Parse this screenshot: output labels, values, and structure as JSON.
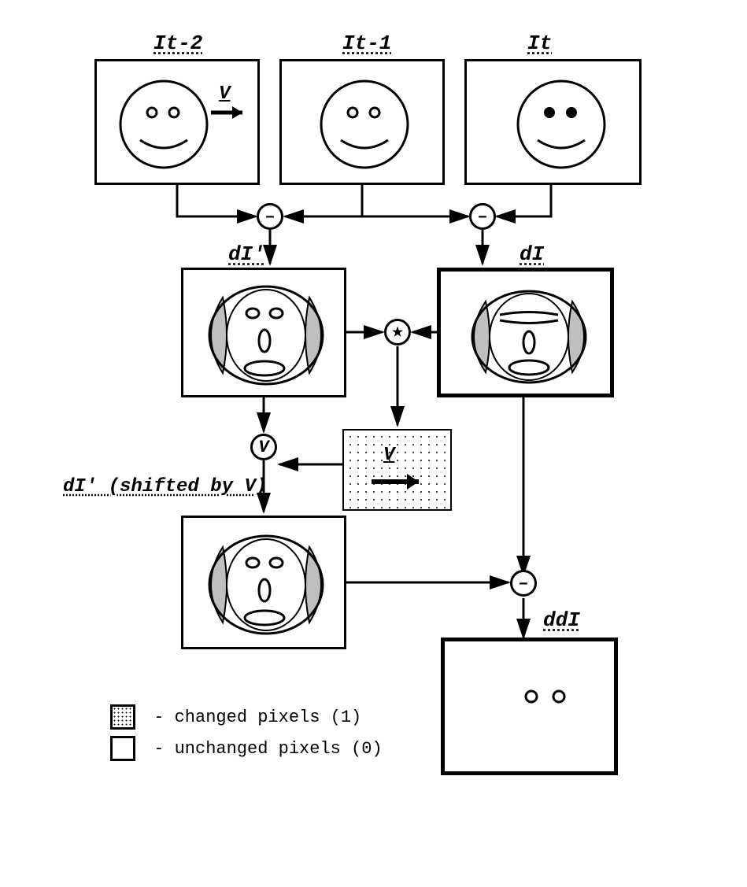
{
  "labels": {
    "it2": "It-2",
    "it1": "It-1",
    "it": "It",
    "dIprime": "dI'",
    "dI": "dI",
    "shifted": "dI' (shifted by V)",
    "ddI": "ddI",
    "V": "V",
    "Vbox": "V"
  },
  "ops": {
    "minus": "–",
    "star": "★",
    "v": "V"
  },
  "legend": {
    "changed": "- changed pixels (1)",
    "unchanged": "- unchanged pixels (0)"
  }
}
